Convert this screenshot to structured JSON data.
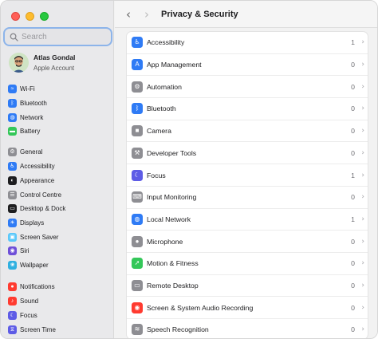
{
  "window": {
    "title": "Privacy & Security",
    "nav_back": "‹",
    "nav_forward": "›"
  },
  "search": {
    "placeholder": "Search",
    "value": ""
  },
  "account": {
    "name": "Atlas Gondal",
    "subtitle": "Apple Account"
  },
  "sidebar": {
    "items": [
      {
        "label": "Wi-Fi",
        "icon": "wifi-icon",
        "color": "#2f7bf5",
        "glyph": "≈"
      },
      {
        "label": "Bluetooth",
        "icon": "bluetooth-icon",
        "color": "#2f7bf5",
        "glyph": "ᛒ"
      },
      {
        "label": "Network",
        "icon": "network-icon",
        "color": "#2f7bf5",
        "glyph": "◍"
      },
      {
        "label": "Battery",
        "icon": "battery-icon",
        "color": "#34c759",
        "glyph": "▬"
      },
      {
        "label": "General",
        "icon": "gear-icon",
        "color": "#8e8e93",
        "glyph": "⚙"
      },
      {
        "label": "Accessibility",
        "icon": "accessibility-icon",
        "color": "#2f7bf5",
        "glyph": "♿"
      },
      {
        "label": "Appearance",
        "icon": "appearance-icon",
        "color": "#1d1d1f",
        "glyph": "◐"
      },
      {
        "label": "Control Centre",
        "icon": "control-centre-icon",
        "color": "#8e8e93",
        "glyph": "☰"
      },
      {
        "label": "Desktop & Dock",
        "icon": "desktop-dock-icon",
        "color": "#1d1d1f",
        "glyph": "▭"
      },
      {
        "label": "Displays",
        "icon": "displays-icon",
        "color": "#2f7bf5",
        "glyph": "☀"
      },
      {
        "label": "Screen Saver",
        "icon": "screen-saver-icon",
        "color": "#5ac8fa",
        "glyph": "▣"
      },
      {
        "label": "Siri",
        "icon": "siri-icon",
        "color": "#6e4fd8",
        "glyph": "◉"
      },
      {
        "label": "Wallpaper",
        "icon": "wallpaper-icon",
        "color": "#30b0e0",
        "glyph": "❀"
      },
      {
        "label": "Notifications",
        "icon": "notifications-icon",
        "color": "#ff3b30",
        "glyph": "●"
      },
      {
        "label": "Sound",
        "icon": "sound-icon",
        "color": "#ff3b30",
        "glyph": "♪"
      },
      {
        "label": "Focus",
        "icon": "focus-icon",
        "color": "#5e5ce6",
        "glyph": "☾"
      },
      {
        "label": "Screen Time",
        "icon": "screen-time-icon",
        "color": "#5e5ce6",
        "glyph": "⧖"
      }
    ]
  },
  "privacy": {
    "rows": [
      {
        "label": "Accessibility",
        "count": "1",
        "icon": "accessibility-icon",
        "color": "#2f7bf5",
        "glyph": "♿"
      },
      {
        "label": "App Management",
        "count": "0",
        "icon": "app-management-icon",
        "color": "#2f7bf5",
        "glyph": "A"
      },
      {
        "label": "Automation",
        "count": "0",
        "icon": "automation-icon",
        "color": "#8e8e93",
        "glyph": "⚙"
      },
      {
        "label": "Bluetooth",
        "count": "0",
        "icon": "bluetooth-icon",
        "color": "#2f7bf5",
        "glyph": "ᛒ"
      },
      {
        "label": "Camera",
        "count": "0",
        "icon": "camera-icon",
        "color": "#8e8e93",
        "glyph": "■"
      },
      {
        "label": "Developer Tools",
        "count": "0",
        "icon": "developer-tools-icon",
        "color": "#8e8e93",
        "glyph": "⚒"
      },
      {
        "label": "Focus",
        "count": "1",
        "icon": "focus-icon",
        "color": "#5e5ce6",
        "glyph": "☾"
      },
      {
        "label": "Input Monitoring",
        "count": "0",
        "icon": "input-monitoring-icon",
        "color": "#8e8e93",
        "glyph": "⌨"
      },
      {
        "label": "Local Network",
        "count": "1",
        "icon": "local-network-icon",
        "color": "#2f7bf5",
        "glyph": "◍"
      },
      {
        "label": "Microphone",
        "count": "0",
        "icon": "microphone-icon",
        "color": "#8e8e93",
        "glyph": "●"
      },
      {
        "label": "Motion & Fitness",
        "count": "0",
        "icon": "motion-fitness-icon",
        "color": "#34c759",
        "glyph": "➚"
      },
      {
        "label": "Remote Desktop",
        "count": "0",
        "icon": "remote-desktop-icon",
        "color": "#8e8e93",
        "glyph": "▭"
      },
      {
        "label": "Screen & System Audio Recording",
        "count": "0",
        "icon": "screen-recording-icon",
        "color": "#ff3b30",
        "glyph": "◉"
      },
      {
        "label": "Speech Recognition",
        "count": "0",
        "icon": "speech-recognition-icon",
        "color": "#8e8e93",
        "glyph": "≋"
      }
    ]
  }
}
